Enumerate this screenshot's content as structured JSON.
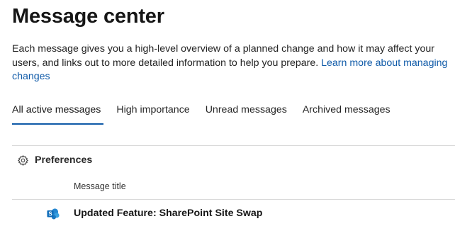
{
  "header": {
    "title": "Message center",
    "intro_text": "Each message gives you a high-level overview of a planned change and how it may affect your users, and links out to more detailed information to help you prepare.",
    "learn_more_link": "Learn more about managing changes"
  },
  "tabs": [
    {
      "label": "All active messages",
      "active": true
    },
    {
      "label": "High importance",
      "active": false
    },
    {
      "label": "Unread messages",
      "active": false
    },
    {
      "label": "Archived messages",
      "active": false
    }
  ],
  "toolbar": {
    "preferences_label": "Preferences",
    "preferences_icon": "gear-icon"
  },
  "table": {
    "columns": [
      "Message title"
    ],
    "rows": [
      {
        "service_icon": "sharepoint-icon",
        "title": "Updated Feature: SharePoint Site Swap"
      }
    ]
  },
  "colors": {
    "accent": "#0f5aa8",
    "sharepoint": "#0a6ab8"
  }
}
